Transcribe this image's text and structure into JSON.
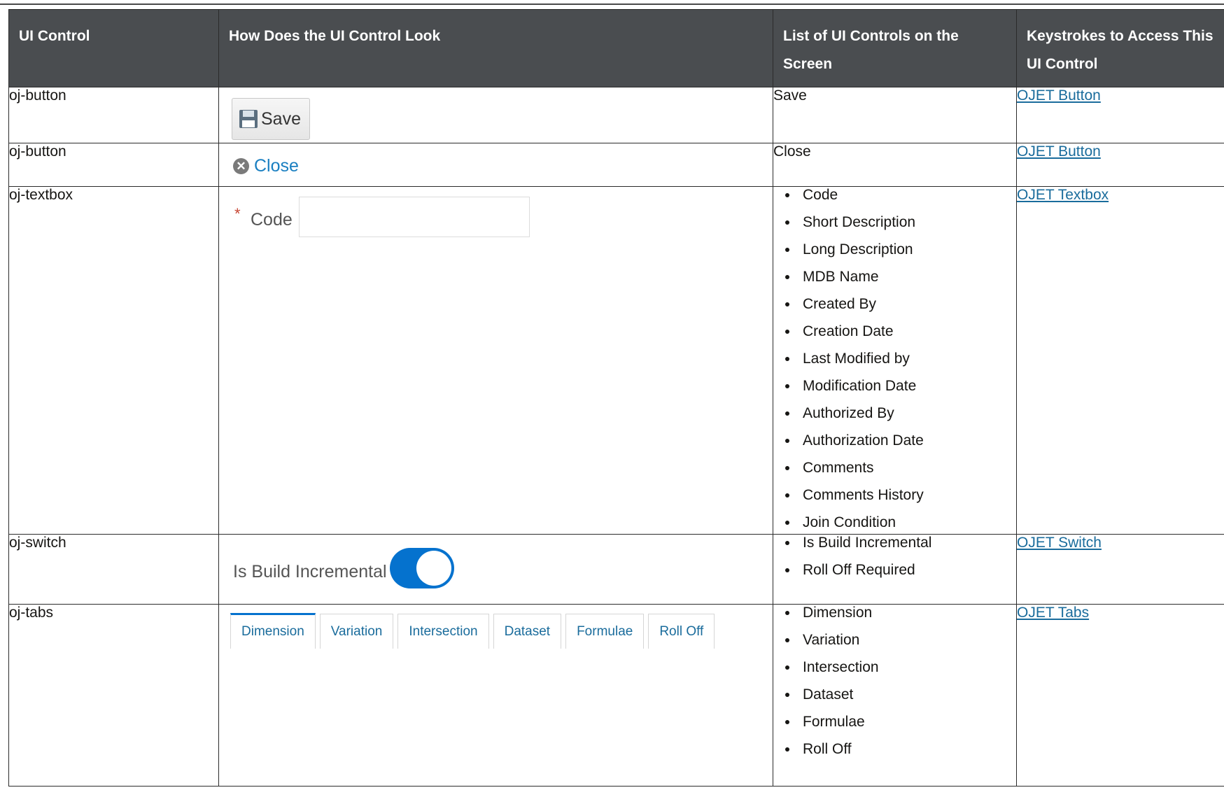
{
  "headers": [
    "UI Control",
    "How Does the UI Control Look",
    "List of UI Controls on the Screen",
    "Keystrokes to Access This UI Control"
  ],
  "rows": [
    {
      "control": "oj-button",
      "controls_list_text": "Save",
      "link": "OJET Button",
      "look": {
        "icon": "floppy-disk-icon",
        "label": "Save"
      }
    },
    {
      "control": "oj-button",
      "controls_list_text": "Close",
      "link": "OJET Button",
      "look": {
        "icon": "close-circle-icon",
        "label": "Close"
      }
    },
    {
      "control": "oj-textbox",
      "link": "OJET Textbox",
      "look": {
        "required_mark": "*",
        "label": "Code",
        "value": ""
      },
      "controls_list": [
        "Code",
        "Short Description",
        "Long Description",
        "MDB Name",
        "Created By",
        "Creation Date",
        "Last Modified by",
        "Modification Date",
        "Authorized By",
        "Authorization Date",
        "Comments",
        "Comments History",
        "Join Condition"
      ]
    },
    {
      "control": "oj-switch",
      "link": "OJET Switch",
      "look": {
        "label": "Is Build Incremental",
        "checked": true
      },
      "controls_list": [
        "Is Build Incremental",
        "Roll Off Required"
      ]
    },
    {
      "control": "oj-tabs",
      "link": "OJET Tabs",
      "look": {
        "tabs": [
          "Dimension",
          "Variation",
          "Intersection",
          "Dataset",
          "Formulae",
          "Roll Off"
        ],
        "active_tab": "Dimension"
      },
      "controls_list": [
        "Dimension",
        "Variation",
        "Intersection",
        "Dataset",
        "Formulae",
        "Roll Off"
      ]
    }
  ],
  "colors": {
    "header_bg": "#4a4d50",
    "link": "#1a6c9c",
    "switch_on": "#0572ce",
    "required": "#c74634"
  }
}
